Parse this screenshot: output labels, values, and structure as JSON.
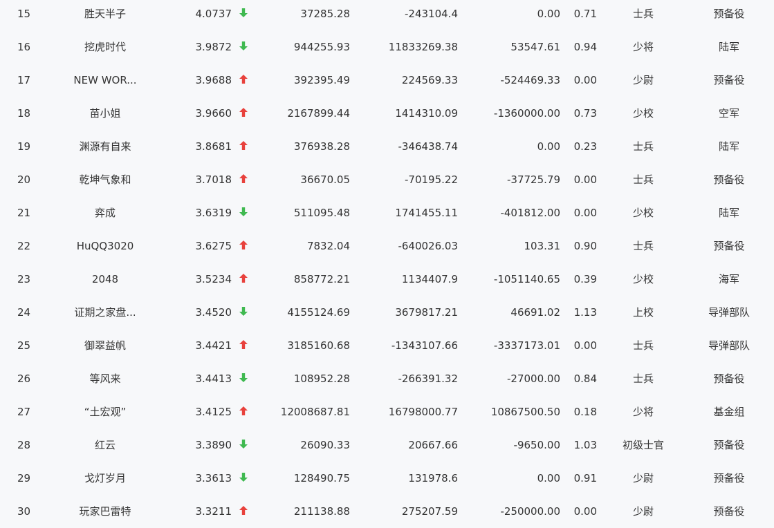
{
  "colors": {
    "up": "#e8413c",
    "down": "#3fb950",
    "background": "#f7f8fa",
    "text": "#333333"
  },
  "rows": [
    {
      "rank": "15",
      "name": "胜天半子",
      "score": "4.0737",
      "trend": "down",
      "v1": "37285.28",
      "v2": "-243104.4",
      "v3": "0.00",
      "ratio": "0.71",
      "title": "士兵",
      "branch": "预备役"
    },
    {
      "rank": "16",
      "name": "挖虎时代",
      "score": "3.9872",
      "trend": "down",
      "v1": "944255.93",
      "v2": "11833269.38",
      "v3": "53547.61",
      "ratio": "0.94",
      "title": "少将",
      "branch": "陆军"
    },
    {
      "rank": "17",
      "name": "NEW WOR...",
      "score": "3.9688",
      "trend": "up",
      "v1": "392395.49",
      "v2": "224569.33",
      "v3": "-524469.33",
      "ratio": "0.00",
      "title": "少尉",
      "branch": "预备役"
    },
    {
      "rank": "18",
      "name": "苗小姐",
      "score": "3.9660",
      "trend": "up",
      "v1": "2167899.44",
      "v2": "1414310.09",
      "v3": "-1360000.00",
      "ratio": "0.73",
      "title": "少校",
      "branch": "空军"
    },
    {
      "rank": "19",
      "name": "渊源有自来",
      "score": "3.8681",
      "trend": "up",
      "v1": "376938.28",
      "v2": "-346438.74",
      "v3": "0.00",
      "ratio": "0.23",
      "title": "士兵",
      "branch": "陆军"
    },
    {
      "rank": "20",
      "name": "乾坤气象和",
      "score": "3.7018",
      "trend": "up",
      "v1": "36670.05",
      "v2": "-70195.22",
      "v3": "-37725.79",
      "ratio": "0.00",
      "title": "士兵",
      "branch": "预备役"
    },
    {
      "rank": "21",
      "name": "弈成",
      "score": "3.6319",
      "trend": "down",
      "v1": "511095.48",
      "v2": "1741455.11",
      "v3": "-401812.00",
      "ratio": "0.00",
      "title": "少校",
      "branch": "陆军"
    },
    {
      "rank": "22",
      "name": "HuQQ3020",
      "score": "3.6275",
      "trend": "up",
      "v1": "7832.04",
      "v2": "-640026.03",
      "v3": "103.31",
      "ratio": "0.90",
      "title": "士兵",
      "branch": "预备役"
    },
    {
      "rank": "23",
      "name": "2048",
      "score": "3.5234",
      "trend": "up",
      "v1": "858772.21",
      "v2": "1134407.9",
      "v3": "-1051140.65",
      "ratio": "0.39",
      "title": "少校",
      "branch": "海军"
    },
    {
      "rank": "24",
      "name": "证期之家盘...",
      "score": "3.4520",
      "trend": "down",
      "v1": "4155124.69",
      "v2": "3679817.21",
      "v3": "46691.02",
      "ratio": "1.13",
      "title": "上校",
      "branch": "导弹部队"
    },
    {
      "rank": "25",
      "name": "御翠益帆",
      "score": "3.4421",
      "trend": "up",
      "v1": "3185160.68",
      "v2": "-1343107.66",
      "v3": "-3337173.01",
      "ratio": "0.00",
      "title": "士兵",
      "branch": "导弹部队"
    },
    {
      "rank": "26",
      "name": "等风来",
      "score": "3.4413",
      "trend": "down",
      "v1": "108952.28",
      "v2": "-266391.32",
      "v3": "-27000.00",
      "ratio": "0.84",
      "title": "士兵",
      "branch": "预备役"
    },
    {
      "rank": "27",
      "name": "“土宏观”",
      "score": "3.4125",
      "trend": "up",
      "v1": "12008687.81",
      "v2": "16798000.77",
      "v3": "10867500.50",
      "ratio": "0.18",
      "title": "少将",
      "branch": "基金组"
    },
    {
      "rank": "28",
      "name": "红云",
      "score": "3.3890",
      "trend": "down",
      "v1": "26090.33",
      "v2": "20667.66",
      "v3": "-9650.00",
      "ratio": "1.03",
      "title": "初级士官",
      "branch": "预备役"
    },
    {
      "rank": "29",
      "name": "戈灯岁月",
      "score": "3.3613",
      "trend": "down",
      "v1": "128490.75",
      "v2": "131978.6",
      "v3": "0.00",
      "ratio": "0.91",
      "title": "少尉",
      "branch": "预备役"
    },
    {
      "rank": "30",
      "name": "玩家巴雷特",
      "score": "3.3211",
      "trend": "up",
      "v1": "211138.88",
      "v2": "275207.59",
      "v3": "-250000.00",
      "ratio": "0.00",
      "title": "少尉",
      "branch": "预备役"
    }
  ]
}
